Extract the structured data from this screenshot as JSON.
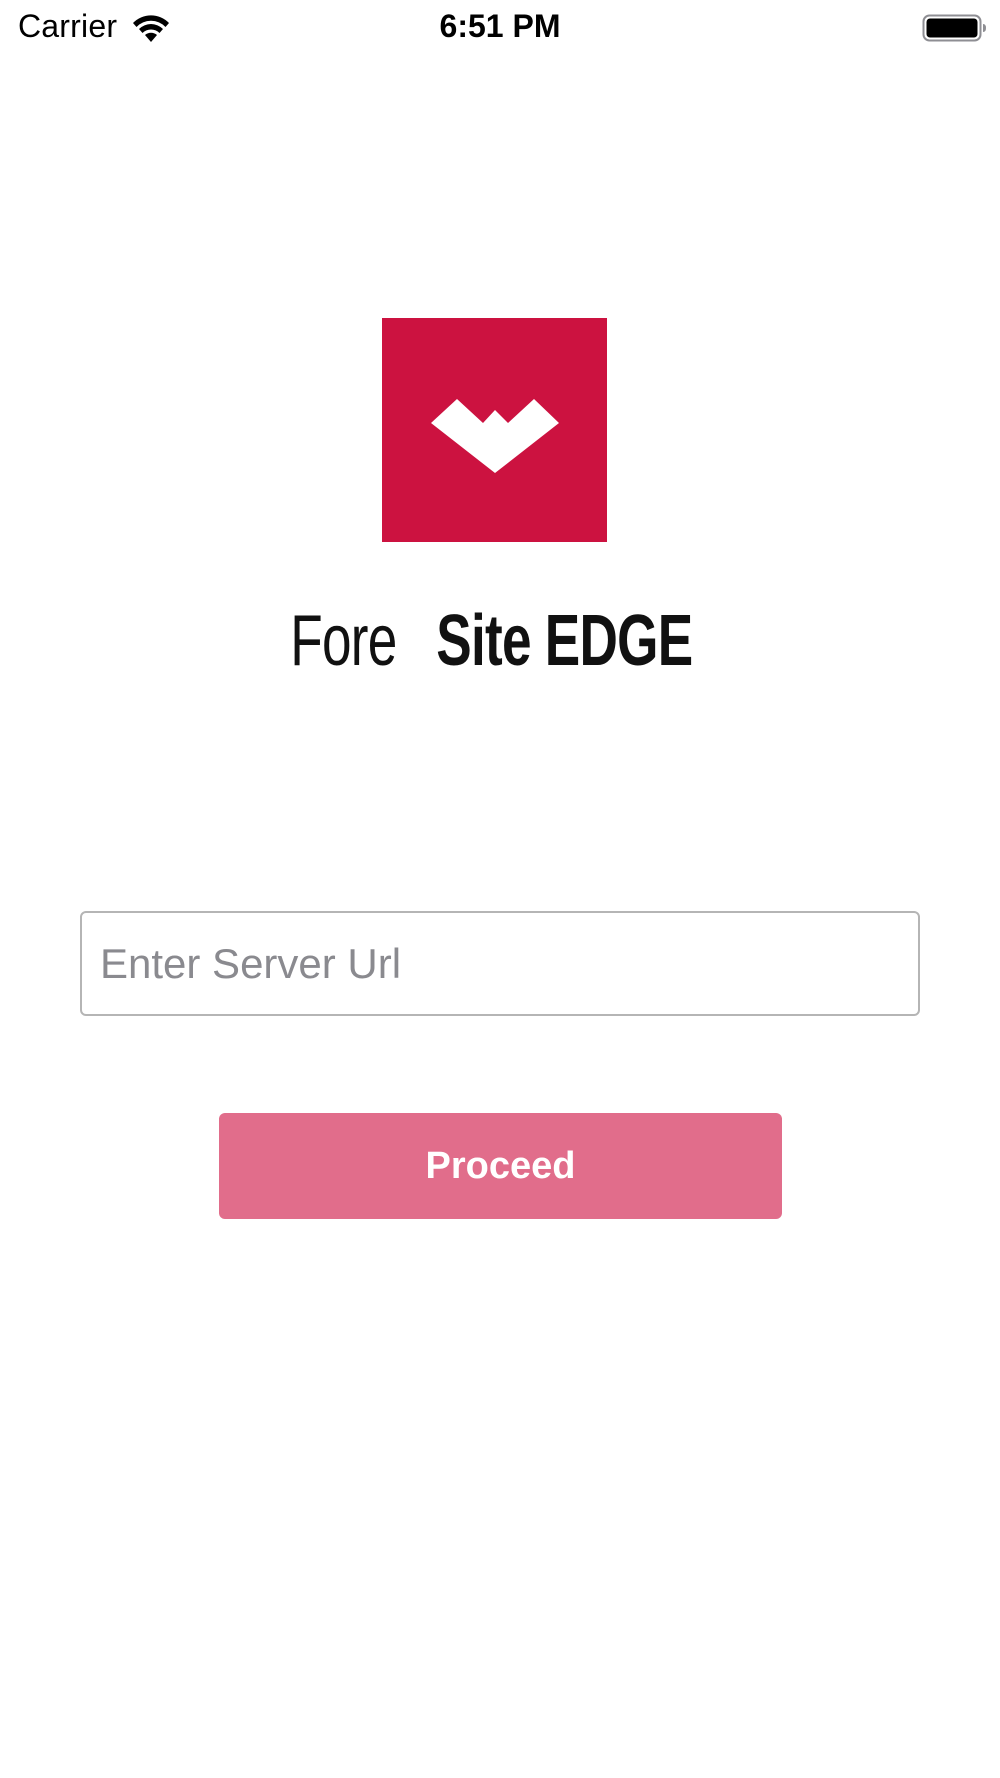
{
  "status_bar": {
    "carrier": "Carrier",
    "time": "6:51 PM",
    "wifi_icon": "wifi-icon",
    "battery_icon": "battery-icon"
  },
  "branding": {
    "logo_icon": "foresite-logo-icon",
    "name_light": "Fore",
    "name_bold": "Site EDGE",
    "brand_color": "#cc1240"
  },
  "form": {
    "server_url": {
      "value": "",
      "placeholder": "Enter Server Url"
    },
    "proceed_label": "Proceed",
    "proceed_color": "#e16d8b"
  }
}
